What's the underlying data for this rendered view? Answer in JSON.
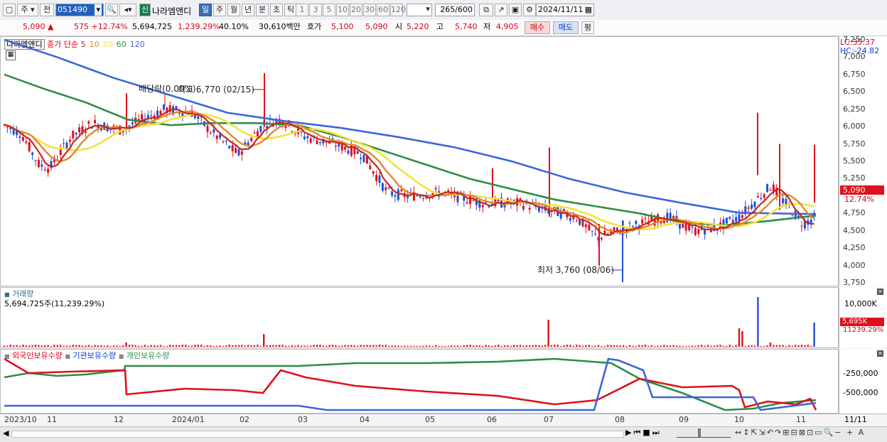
{
  "toolbar": {
    "period_type": "주",
    "prev_label": "전",
    "code": "051490",
    "new_badge": "신",
    "stock_name": "나라엠앤디",
    "periods": [
      "일",
      "주",
      "월",
      "년",
      "분",
      "초",
      "틱"
    ],
    "selected_period": "일",
    "intervals": [
      "1",
      "3",
      "5",
      "10",
      "20",
      "30",
      "60",
      "120"
    ],
    "count": "265",
    "count_total": "/600",
    "date": "2024/11/11"
  },
  "quote": {
    "price": "5,090",
    "change_arrow": "▲",
    "change": "575",
    "change_pct": "+12.74%",
    "volume": "5,694,725",
    "volume_pct": "1,239.29%",
    "turnover": "40.10%",
    "amount": "30,610백만",
    "bid_label": "호가",
    "ask": "5,100",
    "bid": "5,090",
    "open_label": "시",
    "open": "5,220",
    "high_label": "고",
    "high": "5,740",
    "low_label": "저",
    "low": "4,905",
    "buy_label": "매수",
    "sell_label": "매도",
    "even_label": "평"
  },
  "price_panel": {
    "name_tag": "나라엠앤디",
    "legend_prefix": "종가 단순",
    "ma_labels": [
      "5",
      "10",
      "20",
      "60",
      "120"
    ],
    "ma_colors": [
      "#c8261e",
      "#e08a2a",
      "#f4e23a",
      "#2f8c47",
      "#3a67d8"
    ],
    "lc": "LC:35.37",
    "hc": "HC:-24.82",
    "ticks": [
      "7,250",
      "7,000",
      "6,750",
      "6,500",
      "6,250",
      "6,000",
      "5,750",
      "5,500",
      "5,250",
      "4,750",
      "4,500",
      "4,250",
      "4,000",
      "3,750"
    ],
    "last_price_tag": "5,090",
    "last_pct_tag": "12.74%",
    "annot_dividend": "배당락(0.00%)",
    "annot_high": "최고 6,770 (02/15)",
    "annot_low": "최저 3,760 (08/06)"
  },
  "volume_panel": {
    "title": "거래량",
    "subtitle": "5,694,725주(11,239.29%)",
    "tick": "10,000K",
    "last_tag": "5,695K",
    "last_pct": "11239.29%"
  },
  "holder_panel": {
    "series": [
      "외국인보유수량",
      "기관보유수량",
      "개인보유수량"
    ],
    "series_colors": [
      "#e0101b",
      "#3a67d8",
      "#2f8c47"
    ],
    "ticks": [
      "-250,000",
      "-500,000"
    ]
  },
  "x_axis": {
    "labels": [
      "2023/10",
      "11",
      "12",
      "2024/01",
      "02",
      "03",
      "04",
      "05",
      "06",
      "07",
      "08",
      "09",
      "10",
      "11"
    ],
    "right_label": "11/11"
  },
  "chart_data": {
    "type": "candlestick",
    "y_range": [
      3700,
      7300
    ],
    "annotations": {
      "high": 6770,
      "low": 3760,
      "last": 5090
    }
  }
}
